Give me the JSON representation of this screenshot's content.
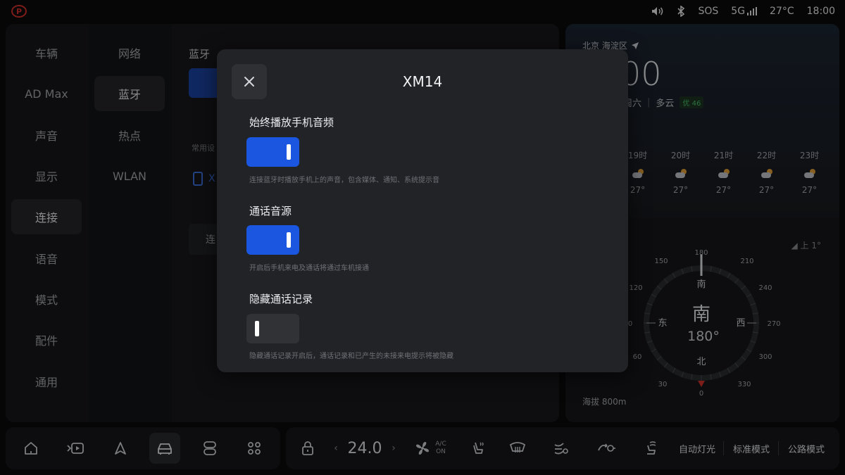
{
  "status_bar": {
    "parking_icon": "parking-brake-icon",
    "sos": "SOS",
    "network": "5G",
    "temperature": "27°C",
    "time": "18:00"
  },
  "nav": {
    "items": [
      {
        "label": "车辆",
        "active": false
      },
      {
        "label": "AD Max",
        "active": false
      },
      {
        "label": "声音",
        "active": false
      },
      {
        "label": "显示",
        "active": false
      },
      {
        "label": "连接",
        "active": true
      },
      {
        "label": "语音",
        "active": false
      },
      {
        "label": "模式",
        "active": false
      },
      {
        "label": "配件",
        "active": false
      },
      {
        "label": "通用",
        "active": false
      }
    ],
    "sub_items": [
      {
        "label": "网络",
        "active": false
      },
      {
        "label": "蓝牙",
        "active": true
      },
      {
        "label": "热点",
        "active": false
      },
      {
        "label": "WLAN",
        "active": false
      }
    ]
  },
  "bluetooth_panel": {
    "title": "蓝牙",
    "section_label": "常用设",
    "device_label": "X",
    "button_label": "连"
  },
  "modal": {
    "title": "XM14",
    "settings": [
      {
        "label": "始终播放手机音频",
        "state": "on",
        "description": "连接蓝牙时播放手机上的声音，包含媒体、通知、系统提示音"
      },
      {
        "label": "通话音源",
        "state": "on",
        "description": "开启后手机来电及通话将通过车机接通"
      },
      {
        "label": "隐藏通话记录",
        "state": "off",
        "description": "隐藏通话记录开启后，通话记录和已产生的未接来电提示将被隐藏"
      }
    ]
  },
  "weather": {
    "location": "北京 海淀区",
    "time_partial": "00",
    "day_partial": "周六",
    "condition": "多云",
    "aqi": "优 46",
    "hourly": [
      {
        "hour": "19时",
        "temp": "27°"
      },
      {
        "hour": "20时",
        "temp": "27°"
      },
      {
        "hour": "21时",
        "temp": "27°"
      },
      {
        "hour": "22时",
        "temp": "27°"
      },
      {
        "hour": "23时",
        "temp": "27°"
      }
    ]
  },
  "compass": {
    "direction": "南",
    "heading": "180°",
    "cardinals": {
      "s": "南",
      "e": "东",
      "w": "西",
      "n": "北"
    },
    "ticks": [
      "180",
      "210",
      "240",
      "270",
      "300",
      "330",
      "0",
      "30",
      "60",
      "0",
      "120",
      "150"
    ],
    "incline": "上 1°",
    "altitude": "海拔 800m"
  },
  "dock": {
    "temp_value": "24.0",
    "ac_label_top": "A/C",
    "ac_label_bottom": "ON",
    "modes": [
      "自动灯光",
      "标准模式",
      "公路模式"
    ]
  }
}
